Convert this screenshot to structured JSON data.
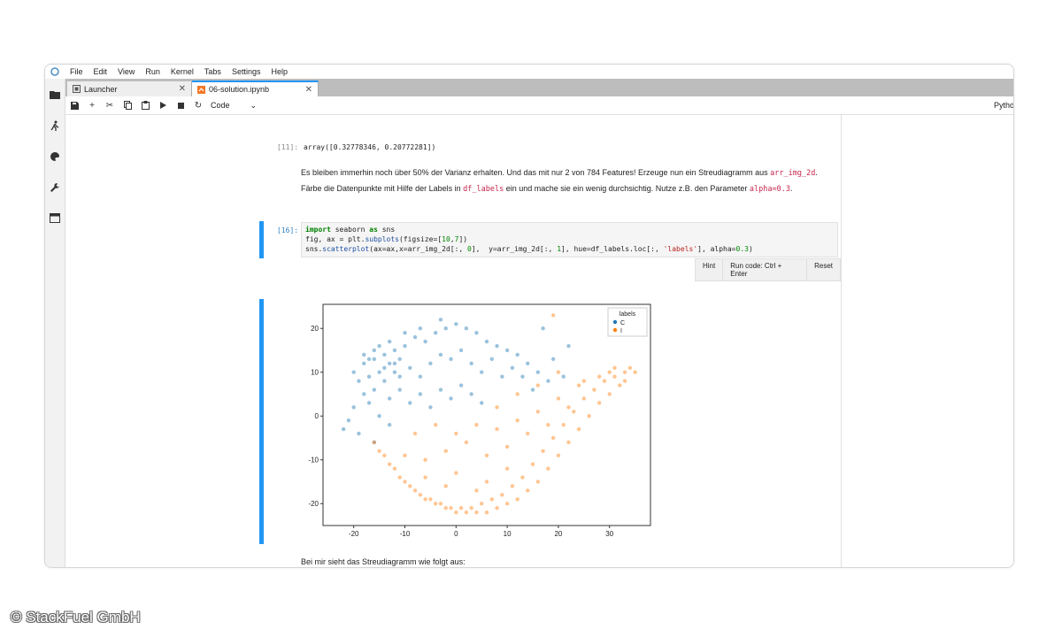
{
  "menubar": {
    "items": [
      "File",
      "Edit",
      "View",
      "Run",
      "Kernel",
      "Tabs",
      "Settings",
      "Help"
    ]
  },
  "tabs": [
    {
      "label": "Launcher",
      "icon": "launcher-icon"
    },
    {
      "label": "06-solution.ipynb",
      "icon": "notebook-icon"
    }
  ],
  "toolbar": {
    "cell_type": "Code",
    "kernel": "Python"
  },
  "cells": {
    "out11_prompt": "[11]:",
    "out11_text": "array([0.32778346, 0.20772281])",
    "md_text_1": "Es bleiben immerhin noch über 50% der Varianz erhalten. Und das mit nur 2 von 784 Features! Erzeuge nun ein Streudiagramm aus",
    "md_code_1": "arr_img_2d",
    "md_text_2": ". Färbe die Datenpunkte mit Hilfe der Labels in",
    "md_code_2": "df_labels",
    "md_text_3": "ein und mache sie ein wenig durchsichtig. Nutze z.B. den Parameter",
    "md_code_3": "alpha=0.3",
    "md_text_4": ".",
    "in16_prompt": "[16]:",
    "code_lines": [
      "import seaborn as sns",
      "fig, ax = plt.subplots(figsize=[10,7])",
      "sns.scatterplot(ax=ax,x=arr_img_2d[:, 0],  y=arr_img_2d[:, 1], hue=df_labels.loc[:, 'labels'], alpha=0.3)"
    ],
    "hint_label": "Hint",
    "run_label": "Run code: Ctrl + Enter",
    "reset_label": "Reset",
    "md_bottom": "Bei mir sieht das Streudiagramm wie folgt aus:"
  },
  "chart_data": {
    "type": "scatter",
    "xticks": [
      -20,
      -10,
      0,
      10,
      20,
      30
    ],
    "yticks": [
      -20,
      -10,
      0,
      10,
      20
    ],
    "xlim": [
      -26,
      38
    ],
    "ylim": [
      -25,
      25.5
    ],
    "legend": {
      "title": "labels",
      "placement": "top-right",
      "entries": [
        "C",
        "I"
      ]
    },
    "series": [
      {
        "name": "C",
        "color": "#1f77b4",
        "points": [
          [
            -18,
            12
          ],
          [
            -16,
            13
          ],
          [
            -15,
            10
          ],
          [
            -14,
            14
          ],
          [
            -17,
            9
          ],
          [
            -13,
            12
          ],
          [
            -12,
            15
          ],
          [
            -15,
            16
          ],
          [
            -19,
            8
          ],
          [
            -18,
            5
          ],
          [
            -20,
            2
          ],
          [
            -21,
            -1
          ],
          [
            -22,
            -3
          ],
          [
            -17,
            3
          ],
          [
            -16,
            6
          ],
          [
            -14,
            8
          ],
          [
            -12,
            10
          ],
          [
            -11,
            13
          ],
          [
            -10,
            16
          ],
          [
            -8,
            18
          ],
          [
            -6,
            17
          ],
          [
            -4,
            19
          ],
          [
            -2,
            20
          ],
          [
            0,
            21
          ],
          [
            2,
            20
          ],
          [
            4,
            19
          ],
          [
            6,
            17
          ],
          [
            8,
            16
          ],
          [
            10,
            15
          ],
          [
            12,
            14
          ],
          [
            14,
            12
          ],
          [
            16,
            10
          ],
          [
            18,
            8
          ],
          [
            -9,
            11
          ],
          [
            -7,
            9
          ],
          [
            -5,
            12
          ],
          [
            -3,
            14
          ],
          [
            -1,
            13
          ],
          [
            1,
            15
          ],
          [
            3,
            12
          ],
          [
            5,
            10
          ],
          [
            7,
            13
          ],
          [
            9,
            9
          ],
          [
            11,
            11
          ],
          [
            13,
            9
          ],
          [
            15,
            6
          ],
          [
            -13,
            4
          ],
          [
            -11,
            6
          ],
          [
            -9,
            3
          ],
          [
            -7,
            5
          ],
          [
            -5,
            2
          ],
          [
            -3,
            6
          ],
          [
            -1,
            4
          ],
          [
            1,
            7
          ],
          [
            3,
            5
          ],
          [
            5,
            3
          ],
          [
            -15,
            0
          ],
          [
            -13,
            -2
          ],
          [
            -19,
            -4
          ],
          [
            -16,
            -6
          ],
          [
            -17,
            13
          ],
          [
            -14,
            11
          ],
          [
            -16,
            15
          ],
          [
            -18,
            14
          ],
          [
            -12,
            12
          ],
          [
            -20,
            10
          ],
          [
            -11,
            9
          ],
          [
            -13,
            17
          ],
          [
            -10,
            19
          ],
          [
            -7,
            20
          ],
          [
            -3,
            22
          ],
          [
            17,
            20
          ],
          [
            22,
            16
          ],
          [
            19,
            13
          ],
          [
            21,
            9
          ]
        ]
      },
      {
        "name": "I",
        "color": "#ff7f0e",
        "points": [
          [
            -15,
            -8
          ],
          [
            -13,
            -11
          ],
          [
            -11,
            -14
          ],
          [
            -9,
            -16
          ],
          [
            -7,
            -18
          ],
          [
            -5,
            -19
          ],
          [
            -3,
            -20
          ],
          [
            -1,
            -21
          ],
          [
            1,
            -21
          ],
          [
            3,
            -21
          ],
          [
            5,
            -20
          ],
          [
            7,
            -19
          ],
          [
            9,
            -18
          ],
          [
            11,
            -16
          ],
          [
            13,
            -14
          ],
          [
            15,
            -11
          ],
          [
            17,
            -8
          ],
          [
            19,
            -5
          ],
          [
            21,
            -2
          ],
          [
            23,
            1
          ],
          [
            25,
            4
          ],
          [
            27,
            6
          ],
          [
            29,
            8
          ],
          [
            31,
            9
          ],
          [
            33,
            10
          ],
          [
            34,
            11
          ],
          [
            32,
            7
          ],
          [
            30,
            5
          ],
          [
            28,
            3
          ],
          [
            26,
            0
          ],
          [
            24,
            -3
          ],
          [
            22,
            -6
          ],
          [
            20,
            -9
          ],
          [
            18,
            -12
          ],
          [
            16,
            -15
          ],
          [
            14,
            -17
          ],
          [
            12,
            -19
          ],
          [
            10,
            -20
          ],
          [
            8,
            -21
          ],
          [
            6,
            -22
          ],
          [
            4,
            -22
          ],
          [
            2,
            -22
          ],
          [
            0,
            -22
          ],
          [
            -2,
            -21
          ],
          [
            -4,
            -20
          ],
          [
            -6,
            -19
          ],
          [
            -8,
            -17
          ],
          [
            -10,
            -15
          ],
          [
            -12,
            -12
          ],
          [
            -14,
            -9
          ],
          [
            -16,
            -6
          ],
          [
            -6,
            -10
          ],
          [
            -2,
            -8
          ],
          [
            2,
            -6
          ],
          [
            6,
            -9
          ],
          [
            10,
            -7
          ],
          [
            14,
            -4
          ],
          [
            -8,
            -4
          ],
          [
            -4,
            -2
          ],
          [
            0,
            -4
          ],
          [
            4,
            -2
          ],
          [
            8,
            -3
          ],
          [
            12,
            -1
          ],
          [
            16,
            1
          ],
          [
            20,
            4
          ],
          [
            24,
            7
          ],
          [
            28,
            9
          ],
          [
            18,
            -2
          ],
          [
            22,
            2
          ],
          [
            -10,
            -9
          ],
          [
            -6,
            -14
          ],
          [
            0,
            -13
          ],
          [
            6,
            -15
          ],
          [
            10,
            -12
          ],
          [
            4,
            -17
          ],
          [
            -2,
            -16
          ],
          [
            8,
            2
          ],
          [
            12,
            5
          ],
          [
            16,
            7
          ],
          [
            20,
            10
          ],
          [
            25,
            8
          ],
          [
            30,
            10
          ],
          [
            31,
            11
          ],
          [
            33,
            8
          ],
          [
            35,
            10
          ],
          [
            19,
            23
          ]
        ]
      }
    ]
  },
  "icons": {
    "sidebar": [
      "folder-icon",
      "running-icon",
      "palette-icon",
      "wrench-icon",
      "tabs-icon"
    ],
    "toolbar": [
      "save-icon",
      "add-icon",
      "cut-icon",
      "copy-icon",
      "paste-icon",
      "run-icon",
      "stop-icon",
      "restart-icon"
    ]
  },
  "copyright": "© StackFuel GmbH"
}
